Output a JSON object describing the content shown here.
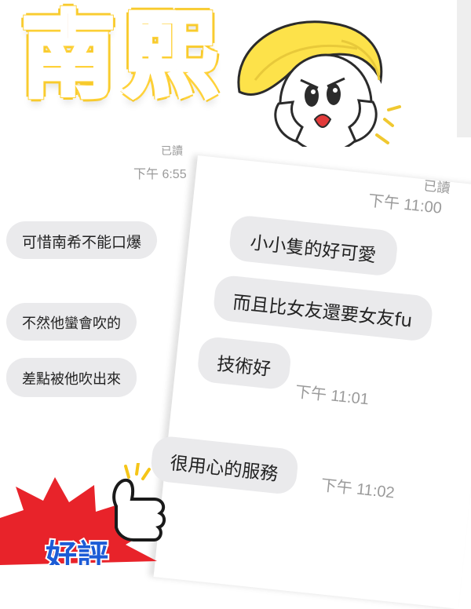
{
  "title": {
    "char1": "南",
    "char2": "熙"
  },
  "left_chat": {
    "read_status": "已讀",
    "time": "下午 6:55",
    "messages": [
      "可惜南希不能口爆",
      "不然他蠻會吹的",
      "差點被他吹出來"
    ]
  },
  "right_chat": {
    "read_status": "已讀",
    "time": "下午 11:00",
    "messages": [
      "小小隻的好可愛",
      "而且比女友還要女友fu",
      "技術好",
      "很用心的服務"
    ],
    "time_2": "下午 11:01",
    "time_3": "下午 11:02"
  },
  "badge": {
    "text": "好評"
  },
  "colors": {
    "title_fill": "#f4a05c",
    "title_glow": "#ffd23a",
    "bubble": "#eaeaec",
    "burst": "#e8232a",
    "badge_text": "#1c5bd6"
  }
}
